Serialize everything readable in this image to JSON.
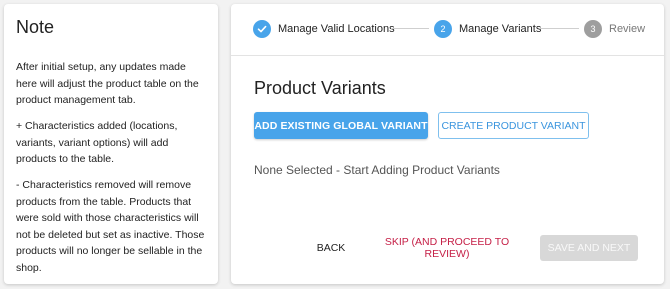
{
  "note": {
    "title": "Note",
    "paragraphs": [
      "After initial setup, any updates made here will adjust the product table on the product management tab.",
      "+ Characteristics added (locations, variants, variant options) will add products to the table.",
      "- Characteristics removed will remove products from the table. Products that were sold with those characteristics will not be deleted but set as inactive. Those products will no longer be sellable in the shop."
    ]
  },
  "stepper": {
    "steps": [
      {
        "label": "Manage Valid Locations",
        "state": "completed",
        "icon": "check-icon"
      },
      {
        "number": "2",
        "label": "Manage Variants",
        "state": "active"
      },
      {
        "number": "3",
        "label": "Review",
        "state": "inactive"
      }
    ]
  },
  "content": {
    "title": "Product Variants",
    "add_existing_label": "ADD EXISTING GLOBAL VARIANT",
    "create_label": "CREATE PRODUCT VARIANT",
    "empty_text": "None Selected - Start Adding Product Variants"
  },
  "footer": {
    "back_label": "BACK",
    "skip_label": "SKIP (AND PROCEED TO REVIEW)",
    "save_label": "SAVE AND NEXT",
    "save_disabled": true
  },
  "colors": {
    "accent": "#48a4ea",
    "skip": "#c51f46",
    "inactive_step": "#9e9e9e"
  }
}
